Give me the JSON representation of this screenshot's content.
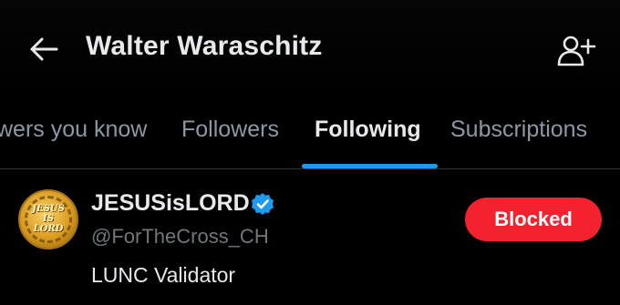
{
  "header": {
    "title": "Walter Waraschitz",
    "back_icon": "arrow-left-icon",
    "add_user_icon": "person-plus-icon"
  },
  "tabs": [
    {
      "label": "Followers you know",
      "visible_text": "wers you know",
      "active": false
    },
    {
      "label": "Followers",
      "active": false
    },
    {
      "label": "Following",
      "active": true
    },
    {
      "label": "Subscriptions",
      "active": false
    }
  ],
  "user": {
    "display_name": "JESUSisLORD",
    "handle": "@ForTheCross_CH",
    "bio": "LUNC Validator",
    "verified": true,
    "avatar_text": "JESUS IS LORD",
    "button_label": "Blocked"
  },
  "colors": {
    "background": "#000000",
    "accent": "#1d9bf0",
    "blocked": "#f4212e",
    "text_primary": "#e7e9ea",
    "text_secondary": "#71767b"
  }
}
